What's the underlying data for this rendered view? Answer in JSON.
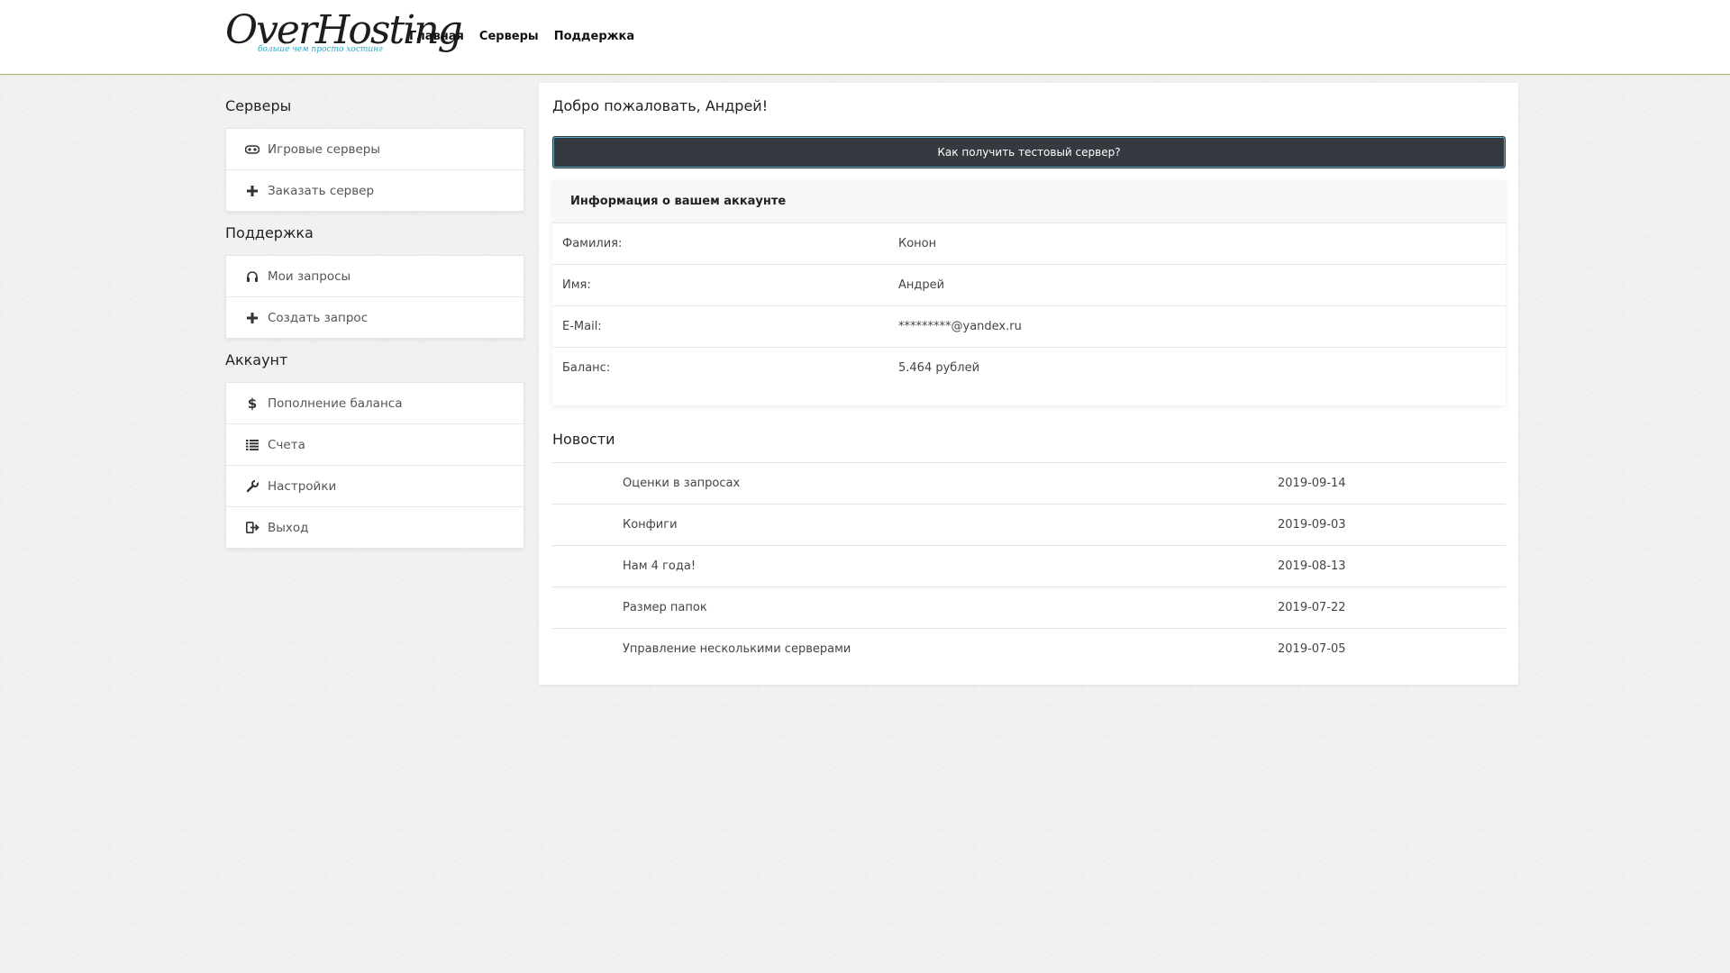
{
  "header": {
    "logo_text": "OverHosting",
    "logo_tagline": "больше чем просто хостинг",
    "nav": [
      "Главная",
      "Серверы",
      "Поддержка"
    ]
  },
  "sidebar": {
    "sections": [
      {
        "title": "Серверы",
        "items": [
          {
            "label": "Игровые серверы",
            "icon": "gamepad-icon"
          },
          {
            "label": "Заказать сервер",
            "icon": "plus-icon"
          }
        ]
      },
      {
        "title": "Поддержка",
        "items": [
          {
            "label": "Мои запросы",
            "icon": "headphones-icon"
          },
          {
            "label": "Создать запрос",
            "icon": "plus-icon"
          }
        ]
      },
      {
        "title": "Аккаунт",
        "items": [
          {
            "label": "Пополнение баланса",
            "icon": "dollar-icon"
          },
          {
            "label": "Счета",
            "icon": "list-icon"
          },
          {
            "label": "Настройки",
            "icon": "wrench-icon"
          },
          {
            "label": "Выход",
            "icon": "logout-icon"
          }
        ]
      }
    ]
  },
  "main": {
    "welcome": "Добро пожаловать, Андрей!",
    "test_button": "Как получить тестовый сервер?",
    "account": {
      "title": "Информация о вашем аккаунте",
      "rows": [
        {
          "label": "Фамилия:",
          "value": "Конон"
        },
        {
          "label": "Имя:",
          "value": "Андрей"
        },
        {
          "label": "E-Mail:",
          "value": "*********@yandex.ru"
        },
        {
          "label": "Баланс:",
          "value": "5.464 рублей"
        }
      ]
    },
    "news": {
      "title": "Новости",
      "items": [
        {
          "title": "Оценки в запросах",
          "date": "2019-09-14"
        },
        {
          "title": "Конфиги",
          "date": "2019-09-03"
        },
        {
          "title": "Нам 4 года!",
          "date": "2019-08-13"
        },
        {
          "title": "Размер папок",
          "date": "2019-07-22"
        },
        {
          "title": "Управление несколькими серверами",
          "date": "2019-07-05"
        }
      ]
    }
  },
  "colors": {
    "header_border": "#a9b96a",
    "button_bg": "#343a40",
    "logo_tagline": "#28a8c8"
  }
}
